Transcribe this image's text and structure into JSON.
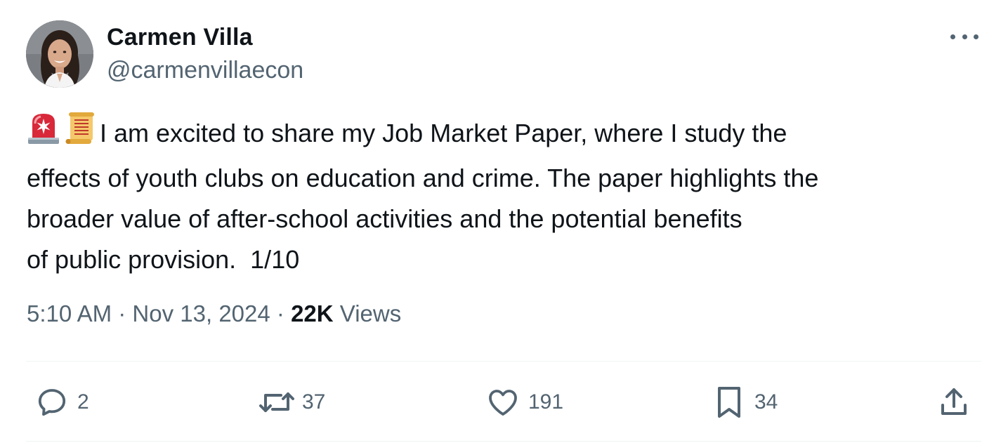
{
  "author": {
    "name": "Carmen Villa",
    "handle": "@carmenvillaecon"
  },
  "tweet": {
    "emojis": [
      "police-light-emoji",
      "scroll-emoji"
    ],
    "lines": [
      "I am excited to share my Job Market Paper, where I study the",
      "effects of youth clubs on education and crime. The paper highlights the",
      "broader value of after-school activities and the potential benefits",
      "of public provision.  1/10"
    ]
  },
  "meta": {
    "time": "5:10 AM",
    "separator": "·",
    "date": "Nov 13, 2024",
    "views_count": "22K",
    "views_label": "Views"
  },
  "actions": {
    "replies": "2",
    "reposts": "37",
    "likes": "191",
    "bookmarks": "34"
  },
  "icons": {
    "more": "more-horizontal-icon",
    "reply": "reply-icon",
    "repost": "repost-icon",
    "like": "heart-icon",
    "bookmark": "bookmark-icon",
    "share": "share-icon"
  },
  "colors": {
    "text": "#0f1419",
    "secondary": "#536471",
    "divider": "#eff3f4"
  }
}
